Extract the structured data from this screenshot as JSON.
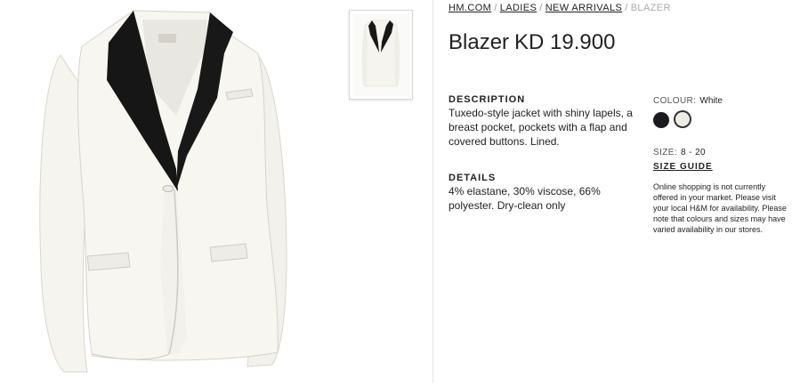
{
  "breadcrumb": {
    "home": "HM.COM",
    "ladies": "LADIES",
    "new_arrivals": "NEW ARRIVALS",
    "current": "BLAZER",
    "separator": "/"
  },
  "product": {
    "name": "Blazer",
    "price": "KD 19.900"
  },
  "description": {
    "heading": "DESCRIPTION",
    "text": "Tuxedo-style jacket with shiny lapels, a breast pocket, pockets with a flap and covered buttons. Lined."
  },
  "details": {
    "heading": "DETAILS",
    "text": "4% elastane, 30% viscose, 66% polyester. Dry-clean only"
  },
  "colour": {
    "label": "COLOUR:",
    "value": "White",
    "swatches": [
      {
        "name": "Black",
        "hex": "#1b1b1f"
      },
      {
        "name": "White",
        "hex": "#efece6",
        "selected": true
      }
    ]
  },
  "size": {
    "label": "SIZE:",
    "value": "8 - 20",
    "guide_label": "SIZE GUIDE"
  },
  "notice": "Online shopping is not currently offered in your market. Please visit your local H&M for availability. Please note that colours and sizes may have varied availability in our stores."
}
